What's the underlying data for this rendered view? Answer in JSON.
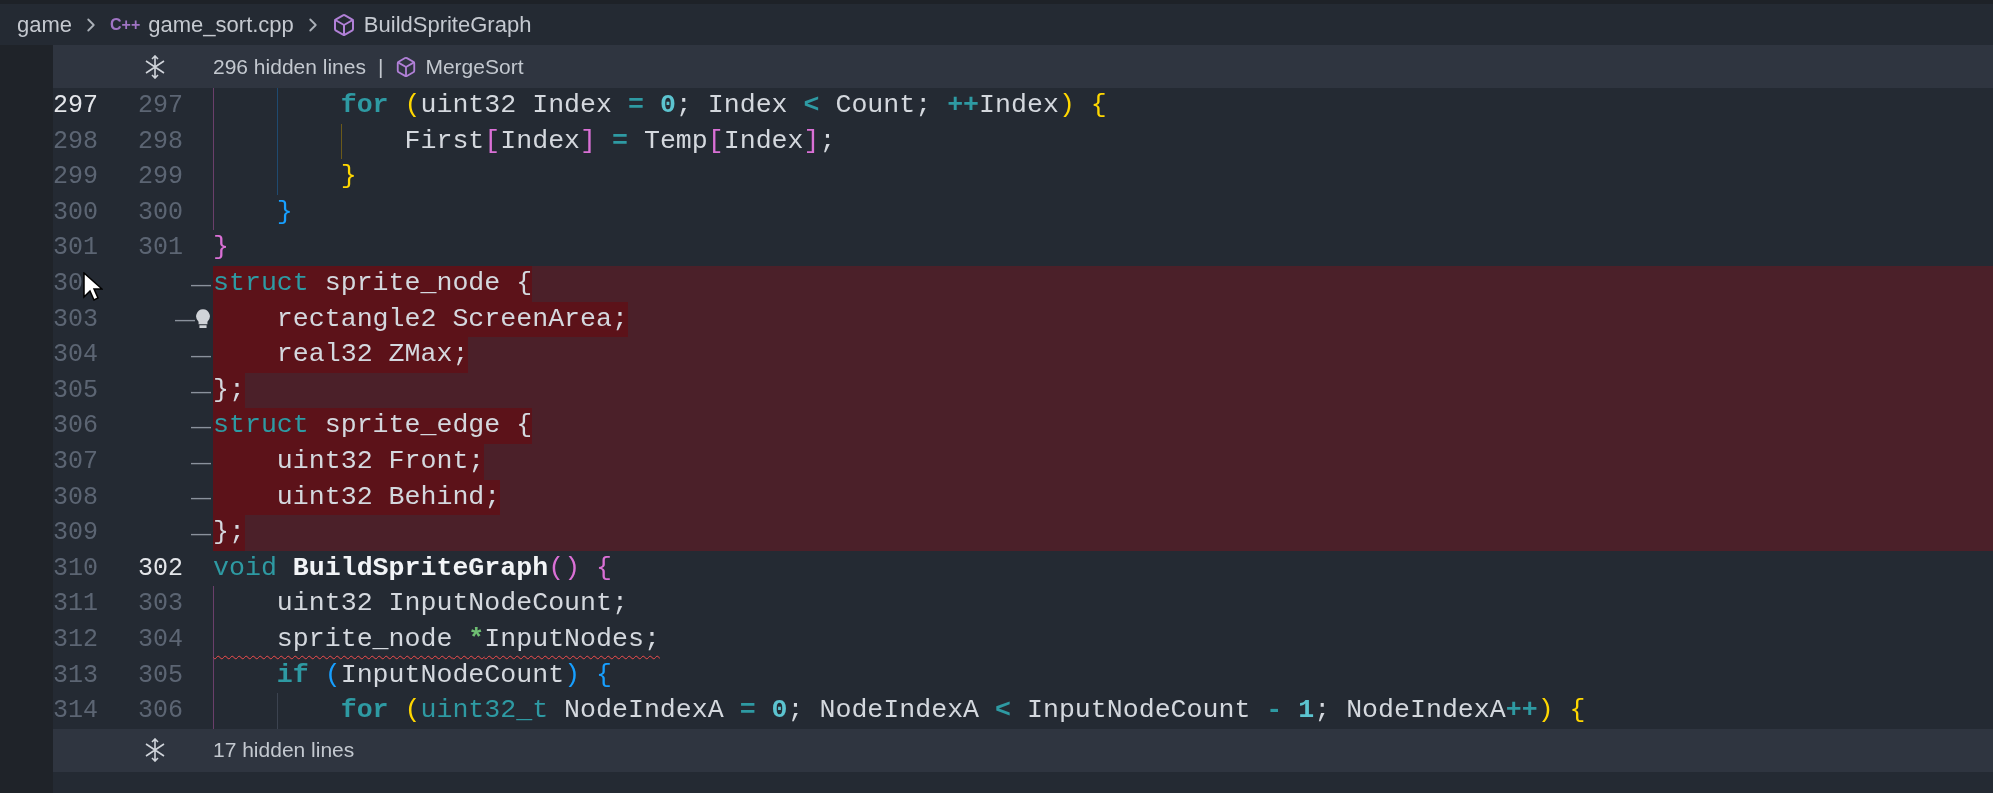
{
  "breadcrumb": [
    {
      "label": "game",
      "symbol": false
    },
    {
      "label": "game_sort.cpp",
      "badge": "C++",
      "symbol": false
    },
    {
      "label": "BuildSpriteGraph",
      "symbol": true
    }
  ],
  "hidden_top": {
    "text": "296 hidden lines",
    "separator": "|",
    "symbol": "MergeSort"
  },
  "lines": [
    {
      "kind": "context",
      "old": "297",
      "new": "297",
      "old_active": true,
      "new_active": false,
      "error": false,
      "lightbulb": false,
      "guides": [
        {
          "color": "#6b3f6b"
        },
        {
          "color": "#1f4a70"
        }
      ],
      "tokens": [
        {
          "text": "        for",
          "kind": "keyword_bold"
        },
        {
          "text": " (",
          "kind": "bracket",
          "color": "#ffd700"
        },
        {
          "text": "uint32 Index",
          "kind": "plain"
        },
        {
          "text": " =",
          "kind": "op"
        },
        {
          "text": " 0",
          "kind": "number"
        },
        {
          "text": "; Index",
          "kind": "plain"
        },
        {
          "text": " <",
          "kind": "op"
        },
        {
          "text": " Count;",
          "kind": "plain"
        },
        {
          "text": " ++",
          "kind": "op"
        },
        {
          "text": "Index",
          "kind": "plain"
        },
        {
          "text": ")",
          "kind": "bracket",
          "color": "#ffd700"
        },
        {
          "text": " {",
          "kind": "bracket",
          "color": "#ffd700"
        }
      ]
    },
    {
      "kind": "context",
      "old": "298",
      "new": "298",
      "old_active": false,
      "new_active": false,
      "error": false,
      "lightbulb": false,
      "guides": [
        {
          "color": "#6b3f6b"
        },
        {
          "color": "#1f4a70"
        },
        {
          "color": "#6b5a1a"
        }
      ],
      "tokens": [
        {
          "text": "            First",
          "kind": "plain"
        },
        {
          "text": "[",
          "kind": "bracket",
          "color": "#da70d6"
        },
        {
          "text": "Index",
          "kind": "plain"
        },
        {
          "text": "]",
          "kind": "bracket",
          "color": "#da70d6"
        },
        {
          "text": " =",
          "kind": "op"
        },
        {
          "text": " Temp",
          "kind": "plain"
        },
        {
          "text": "[",
          "kind": "bracket",
          "color": "#da70d6"
        },
        {
          "text": "Index",
          "kind": "plain"
        },
        {
          "text": "]",
          "kind": "bracket",
          "color": "#da70d6"
        },
        {
          "text": ";",
          "kind": "plain"
        }
      ]
    },
    {
      "kind": "context",
      "old": "299",
      "new": "299",
      "old_active": false,
      "new_active": false,
      "error": false,
      "lightbulb": false,
      "guides": [
        {
          "color": "#6b3f6b"
        },
        {
          "color": "#1f4a70"
        }
      ],
      "tokens": [
        {
          "text": "        }",
          "kind": "bracket",
          "color": "#ffd700"
        }
      ]
    },
    {
      "kind": "context",
      "old": "300",
      "new": "300",
      "old_active": false,
      "new_active": false,
      "error": false,
      "lightbulb": false,
      "guides": [
        {
          "color": "#6b3f6b"
        }
      ],
      "tokens": [
        {
          "text": "    }",
          "kind": "bracket",
          "color": "#179fff"
        }
      ]
    },
    {
      "kind": "context",
      "old": "301",
      "new": "301",
      "old_active": false,
      "new_active": false,
      "error": false,
      "lightbulb": false,
      "tokens": [
        {
          "text": "}",
          "kind": "bracket",
          "color": "#da70d6"
        }
      ]
    },
    {
      "kind": "deleted",
      "old": "30",
      "marker": "—",
      "old_active": false,
      "error": false,
      "lightbulb": false,
      "tokens": [
        {
          "text": "struct",
          "kind": "keyword"
        },
        {
          "text": " sprite_node {",
          "kind": "plain"
        }
      ]
    },
    {
      "kind": "deleted",
      "old": "303",
      "marker": "—",
      "old_active": false,
      "error": false,
      "lightbulb": true,
      "tokens": [
        {
          "text": "    rectangle2 ScreenArea;",
          "kind": "plain"
        }
      ]
    },
    {
      "kind": "deleted",
      "old": "304",
      "marker": "—",
      "old_active": false,
      "error": false,
      "lightbulb": false,
      "tokens": [
        {
          "text": "    real32 ZMax;",
          "kind": "plain"
        }
      ]
    },
    {
      "kind": "deleted",
      "old": "305",
      "marker": "—",
      "old_active": false,
      "error": false,
      "lightbulb": false,
      "tokens": [
        {
          "text": "};",
          "kind": "plain"
        }
      ]
    },
    {
      "kind": "deleted",
      "old": "306",
      "marker": "—",
      "old_active": false,
      "error": false,
      "lightbulb": false,
      "tokens": [
        {
          "text": "struct",
          "kind": "keyword"
        },
        {
          "text": " sprite_edge {",
          "kind": "plain"
        }
      ]
    },
    {
      "kind": "deleted",
      "old": "307",
      "marker": "—",
      "old_active": false,
      "error": false,
      "lightbulb": false,
      "tokens": [
        {
          "text": "    uint32 Front;",
          "kind": "plain"
        }
      ]
    },
    {
      "kind": "deleted",
      "old": "308",
      "marker": "—",
      "old_active": false,
      "error": false,
      "lightbulb": false,
      "tokens": [
        {
          "text": "    uint32 Behind;",
          "kind": "plain"
        }
      ]
    },
    {
      "kind": "deleted",
      "old": "309",
      "marker": "—",
      "old_active": false,
      "error": false,
      "lightbulb": false,
      "tokens": [
        {
          "text": "};",
          "kind": "plain"
        }
      ]
    },
    {
      "kind": "context",
      "old": "310",
      "new": "302",
      "old_active": false,
      "new_active": true,
      "error": false,
      "lightbulb": false,
      "tokens": [
        {
          "text": "void",
          "kind": "keyword"
        },
        {
          "text": " BuildSpriteGraph",
          "kind": "fn"
        },
        {
          "text": "(",
          "kind": "bracket",
          "color": "#da70d6"
        },
        {
          "text": ")",
          "kind": "bracket",
          "color": "#da70d6"
        },
        {
          "text": " {",
          "kind": "bracket",
          "color": "#da70d6"
        }
      ]
    },
    {
      "kind": "context",
      "old": "311",
      "new": "303",
      "old_active": false,
      "new_active": false,
      "error": false,
      "lightbulb": false,
      "guides": [
        {
          "color": "#6b3f6b"
        }
      ],
      "tokens": [
        {
          "text": "    uint32 InputNodeCount;",
          "kind": "plain"
        }
      ]
    },
    {
      "kind": "context",
      "old": "312",
      "new": "304",
      "old_active": false,
      "new_active": false,
      "error": true,
      "lightbulb": false,
      "guides": [
        {
          "color": "#6b3f6b"
        }
      ],
      "tokens": [
        {
          "text": "    sprite_node",
          "kind": "plain"
        },
        {
          "text": " *",
          "kind": "ptr"
        },
        {
          "text": "InputNodes;",
          "kind": "plain"
        }
      ]
    },
    {
      "kind": "context",
      "old": "313",
      "new": "305",
      "old_active": false,
      "new_active": false,
      "error": false,
      "lightbulb": false,
      "guides": [
        {
          "color": "#6b3f6b"
        }
      ],
      "tokens": [
        {
          "text": "    if",
          "kind": "keyword_bold"
        },
        {
          "text": " (",
          "kind": "bracket",
          "color": "#179fff"
        },
        {
          "text": "InputNodeCount",
          "kind": "plain"
        },
        {
          "text": ")",
          "kind": "bracket",
          "color": "#179fff"
        },
        {
          "text": " {",
          "kind": "bracket",
          "color": "#179fff"
        }
      ]
    },
    {
      "kind": "context",
      "old": "314",
      "new": "306",
      "old_active": false,
      "new_active": false,
      "error": false,
      "lightbulb": false,
      "guides": [
        {
          "color": "#6b3f6b"
        },
        {
          "color": "#3c4350"
        }
      ],
      "tokens": [
        {
          "text": "        for",
          "kind": "keyword_bold"
        },
        {
          "text": " (",
          "kind": "bracket",
          "color": "#ffd700"
        },
        {
          "text": "uint32_t",
          "kind": "builtin"
        },
        {
          "text": " NodeIndexA",
          "kind": "plain"
        },
        {
          "text": " =",
          "kind": "op"
        },
        {
          "text": " 0",
          "kind": "number"
        },
        {
          "text": "; NodeIndexA",
          "kind": "plain"
        },
        {
          "text": " <",
          "kind": "op"
        },
        {
          "text": " InputNodeCount",
          "kind": "plain"
        },
        {
          "text": " -",
          "kind": "op"
        },
        {
          "text": " 1",
          "kind": "number"
        },
        {
          "text": "; NodeIndexA",
          "kind": "plain"
        },
        {
          "text": "++",
          "kind": "op"
        },
        {
          "text": ")",
          "kind": "bracket",
          "color": "#ffd700"
        },
        {
          "text": " {",
          "kind": "bracket",
          "color": "#ffd700"
        }
      ]
    }
  ],
  "hidden_bottom": {
    "text": "17 hidden lines"
  }
}
